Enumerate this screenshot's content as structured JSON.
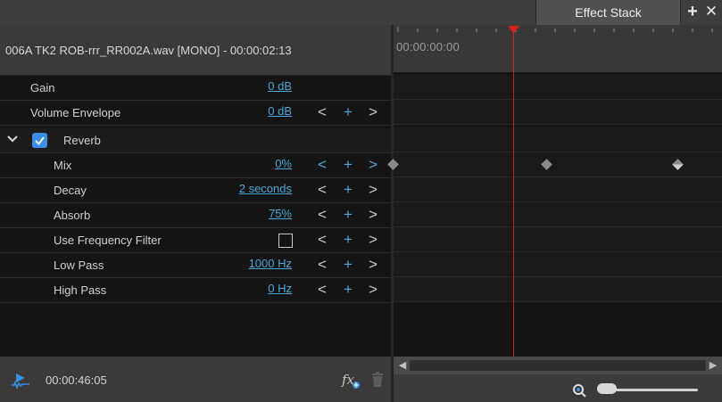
{
  "tabs": {
    "active_label": "Effect Stack",
    "add_symbol": "+",
    "close_symbol": "✕"
  },
  "clip": {
    "title": "006A TK2 ROB-rrr_RR002A.wav  [MONO] - 00:00:02:13"
  },
  "params": [
    {
      "label": "Gain",
      "value": "0 dB"
    },
    {
      "label": "Volume Envelope",
      "value": "0 dB"
    },
    {
      "label": "Reverb",
      "enabled": true
    },
    {
      "label": "Mix",
      "value": "0%"
    },
    {
      "label": "Decay",
      "value": "2 seconds"
    },
    {
      "label": "Absorb",
      "value": "75%"
    },
    {
      "label": "Use Frequency Filter",
      "checked": false
    },
    {
      "label": "Low Pass",
      "value": "1000 Hz"
    },
    {
      "label": "High Pass",
      "value": "0 Hz"
    }
  ],
  "nav": {
    "prev": "<",
    "add": "+",
    "next": ">"
  },
  "footer": {
    "timecode": "00:00:46:05",
    "fx_label": "fx"
  },
  "timeline": {
    "ruler_time": "00:00:00:00"
  },
  "colors": {
    "accent": "#45a8d6",
    "playhead": "#d42020",
    "panel": "#141414"
  }
}
